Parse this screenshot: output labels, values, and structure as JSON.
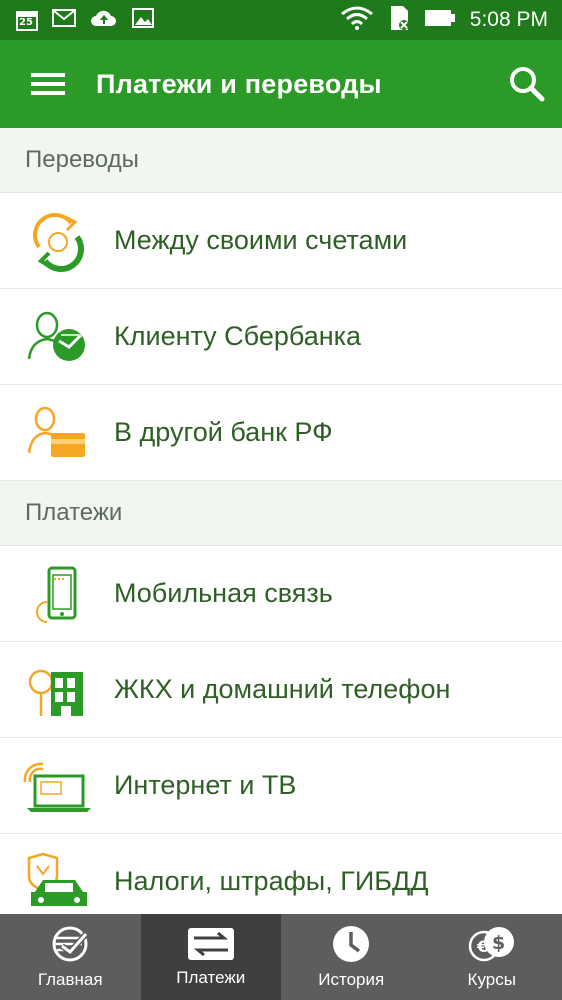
{
  "statusbar": {
    "calendar_day": "25",
    "time": "5:08 PM"
  },
  "appbar": {
    "title": "Платежи и переводы"
  },
  "sections": [
    {
      "title": "Переводы",
      "items": [
        {
          "label": "Между своими счетами",
          "icon": "accounts-transfer-icon"
        },
        {
          "label": "Клиенту Сбербанка",
          "icon": "sberbank-client-icon"
        },
        {
          "label": "В другой банк РФ",
          "icon": "other-bank-icon"
        }
      ]
    },
    {
      "title": "Платежи",
      "items": [
        {
          "label": "Мобильная связь",
          "icon": "mobile-phone-icon"
        },
        {
          "label": "ЖКХ и домашний телефон",
          "icon": "housing-icon"
        },
        {
          "label": "Интернет и ТВ",
          "icon": "internet-tv-icon"
        },
        {
          "label": "Налоги, штрафы, ГИБДД",
          "icon": "taxes-car-icon"
        }
      ]
    }
  ],
  "bottom_nav": [
    {
      "label": "Главная",
      "icon": "sberbank-logo-icon",
      "active": false
    },
    {
      "label": "Платежи",
      "icon": "transfer-card-icon",
      "active": true
    },
    {
      "label": "История",
      "icon": "clock-icon",
      "active": false
    },
    {
      "label": "Курсы",
      "icon": "currency-icon",
      "active": false
    }
  ],
  "colors": {
    "statusbar": "#1e7a1b",
    "appbar": "#2c9a26",
    "accent_green": "#2c9a26",
    "accent_orange": "#f5a623",
    "bottom_nav": "#5d5d5d"
  }
}
